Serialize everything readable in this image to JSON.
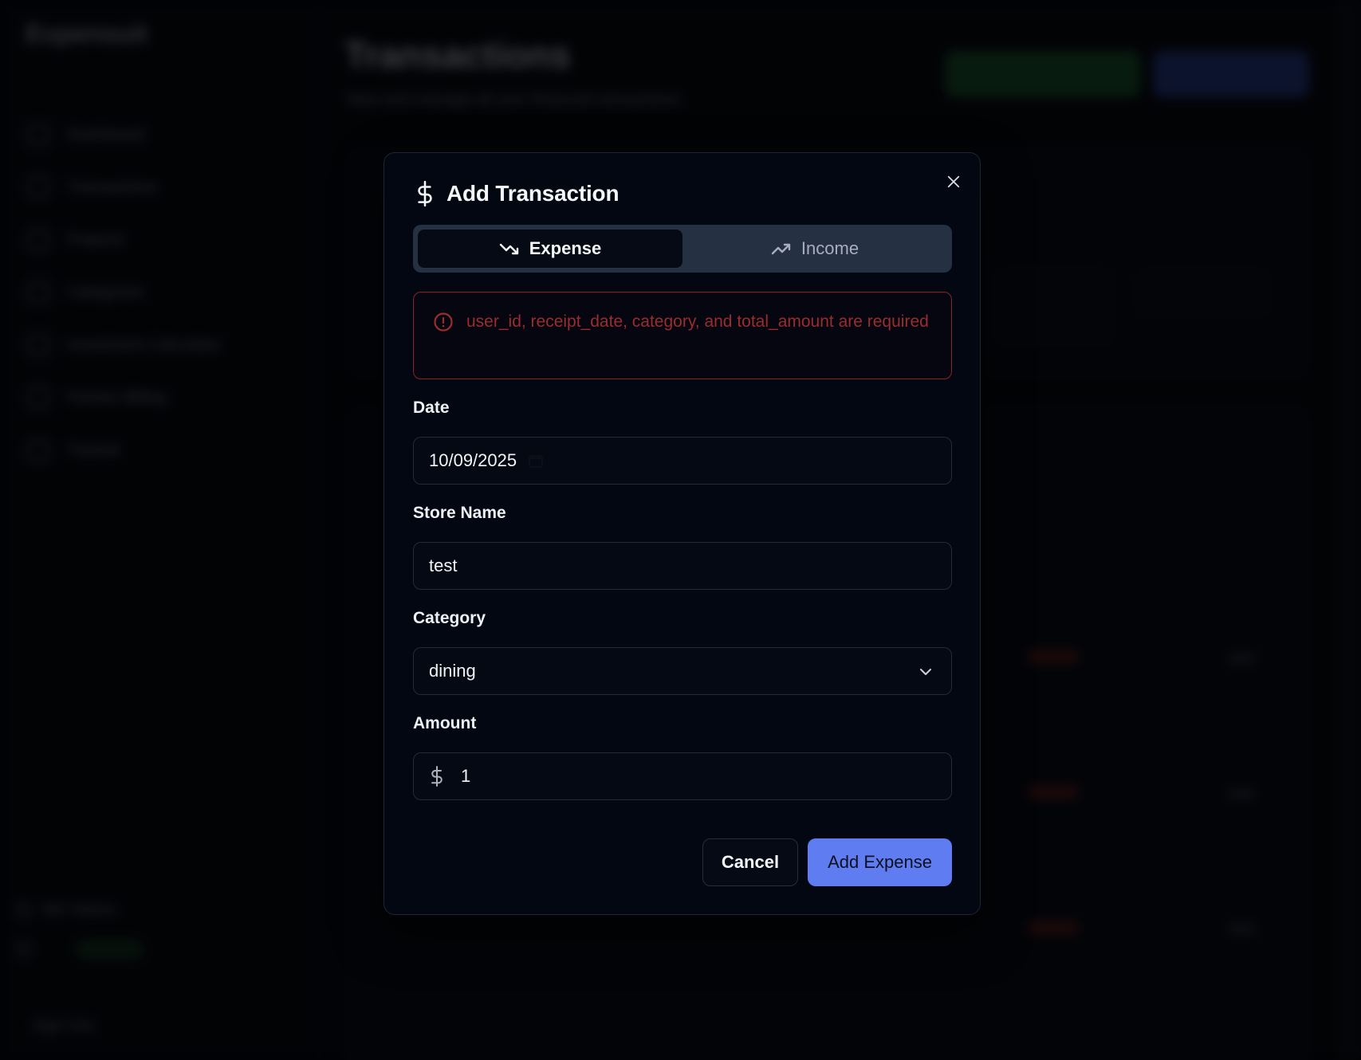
{
  "background": {
    "brand": "Expensuit",
    "page_title": "Transactions",
    "page_subtitle": "View and manage all your financial transactions",
    "nav": [
      {
        "label": "Dashboard"
      },
      {
        "label": "Transactions"
      },
      {
        "label": "Projects"
      },
      {
        "label": "Categories"
      },
      {
        "label": "Investment Calculator"
      },
      {
        "label": "Partner Billing"
      },
      {
        "label": "Tutorial"
      }
    ],
    "bot_status": "Bot Status",
    "signout": "Sign Out"
  },
  "modal": {
    "title": "Add Transaction",
    "toggle": {
      "expense_label": "Expense",
      "income_label": "Income",
      "active": "expense"
    },
    "error_message": "user_id, receipt_date, category, and total_amount are required",
    "fields": {
      "date": {
        "label": "Date",
        "value": "10/09/2025"
      },
      "store_name": {
        "label": "Store Name",
        "value": "test"
      },
      "category": {
        "label": "Category",
        "value": "dining"
      },
      "amount": {
        "label": "Amount",
        "value": "1"
      }
    },
    "buttons": {
      "cancel": "Cancel",
      "submit": "Add Expense"
    }
  },
  "colors": {
    "accent": "#5f7df0",
    "error": "#8b2227",
    "surface": "#030712"
  },
  "icons": {
    "title": "dollar-icon",
    "expense": "trending-down-icon",
    "income": "trending-up-icon",
    "error": "alert-circle-icon",
    "close": "close-icon",
    "date": "calendar-icon",
    "category": "chevron-down-icon",
    "amount": "dollar-icon"
  }
}
